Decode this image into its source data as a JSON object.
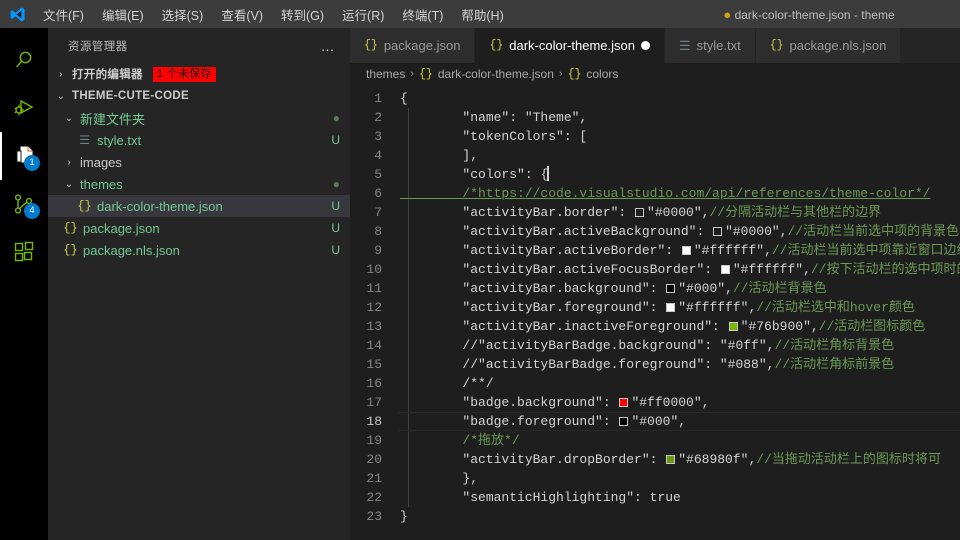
{
  "titlebar": {
    "logo_icon": "vscode-logo",
    "menus": [
      {
        "label": "文件(F)"
      },
      {
        "label": "编辑(E)"
      },
      {
        "label": "选择(S)"
      },
      {
        "label": "查看(V)"
      },
      {
        "label": "转到(G)"
      },
      {
        "label": "运行(R)"
      },
      {
        "label": "终端(T)"
      },
      {
        "label": "帮助(H)"
      }
    ],
    "dirty_dot": "●",
    "window_title": "dark-color-theme.json - theme"
  },
  "activitybar": {
    "items": [
      {
        "name": "search",
        "icon": "search-icon",
        "badge": null,
        "active": false
      },
      {
        "name": "run-and-debug",
        "icon": "run-debug-icon",
        "badge": null,
        "active": false
      },
      {
        "name": "explorer",
        "icon": "files-icon",
        "badge": "1",
        "active": true
      },
      {
        "name": "source-control",
        "icon": "source-control-icon",
        "badge": "4",
        "active": false
      },
      {
        "name": "extensions",
        "icon": "extensions-icon",
        "badge": null,
        "active": false
      }
    ],
    "badge_color": "#007acc",
    "icon_color": "#76b900"
  },
  "sidebar": {
    "title": "资源管理器",
    "more_actions": "…",
    "open_editors": {
      "label": "打开的编辑器",
      "badge": "1 个未保存",
      "badge_bg": "#ff0000",
      "twisty": "›"
    },
    "project": {
      "label": "THEME-CUTE-CODE",
      "twisty": "⌄"
    },
    "tree": [
      {
        "label": "新建文件夹",
        "type": "folder",
        "twisty": "⌄",
        "indent": 1,
        "status": "",
        "dot": true,
        "selected": false
      },
      {
        "label": "style.txt",
        "type": "txt",
        "twisty": "",
        "indent": 2,
        "status": "U",
        "dot": false,
        "selected": false
      },
      {
        "label": "images",
        "type": "folder",
        "twisty": "›",
        "indent": 1,
        "status": "",
        "dot": false,
        "selected": false
      },
      {
        "label": "themes",
        "type": "folder",
        "twisty": "⌄",
        "indent": 1,
        "status": "",
        "dot": true,
        "selected": false
      },
      {
        "label": "dark-color-theme.json",
        "type": "json",
        "twisty": "",
        "indent": 2,
        "status": "U",
        "dot": false,
        "selected": true
      },
      {
        "label": "package.json",
        "type": "json",
        "twisty": "",
        "indent": 1,
        "status": "U",
        "dot": false,
        "selected": false
      },
      {
        "label": "package.nls.json",
        "type": "json",
        "twisty": "",
        "indent": 1,
        "status": "U",
        "dot": false,
        "selected": false
      }
    ]
  },
  "editor": {
    "tabs": [
      {
        "label": "package.json",
        "icon": "json-icon",
        "active": false,
        "dirty": false
      },
      {
        "label": "dark-color-theme.json",
        "icon": "json-icon",
        "active": true,
        "dirty": true
      },
      {
        "label": "style.txt",
        "icon": "txt-icon",
        "active": false,
        "dirty": false
      },
      {
        "label": "package.nls.json",
        "icon": "json-icon",
        "active": false,
        "dirty": false
      }
    ],
    "breadcrumb": [
      {
        "label": "themes",
        "icon": ""
      },
      {
        "label": "dark-color-theme.json",
        "icon": "json-icon"
      },
      {
        "label": "colors",
        "icon": "json-icon"
      }
    ],
    "breadcrumb_separator": "›",
    "current_line": 18,
    "lines": [
      {
        "n": 1,
        "text": "{"
      },
      {
        "n": 2,
        "text": "        \"name\": \"Theme\","
      },
      {
        "n": 3,
        "text": "        \"tokenColors\": ["
      },
      {
        "n": 4,
        "text": "        ],"
      },
      {
        "n": 5,
        "text": "        \"colors\": {"
      },
      {
        "n": 6,
        "text": "        /*https://code.visualstudio.com/api/references/theme-color*/"
      },
      {
        "n": 7,
        "text": "        \"activityBar.border\":  \"#0000\",//分隔活动栏与其他栏的边界"
      },
      {
        "n": 8,
        "text": "        \"activityBar.activeBackground\":  \"#0000\",//活动栏当前选中项的背景色"
      },
      {
        "n": 9,
        "text": "        \"activityBar.activeBorder\":  \"#ffffff\",//活动栏当前选中项靠近窗口边缘的边框"
      },
      {
        "n": 10,
        "text": "        \"activityBar.activeFocusBorder\":  \"#ffffff\",//按下活动栏的选中项时的边框"
      },
      {
        "n": 11,
        "text": "        \"activityBar.background\":  \"#000\",//活动栏背景色"
      },
      {
        "n": 12,
        "text": "        \"activityBar.foreground\":  \"#ffffff\",//活动栏选中和hover颜色"
      },
      {
        "n": 13,
        "text": "        \"activityBar.inactiveForeground\":  \"#76b900\",//活动栏图标颜色"
      },
      {
        "n": 14,
        "text": "        //\"activityBarBadge.background\": \"#0ff\",//活动栏角标背景色"
      },
      {
        "n": 15,
        "text": "        //\"activityBarBadge.foreground\": \"#088\",//活动栏角标前景色"
      },
      {
        "n": 16,
        "text": "        /**/"
      },
      {
        "n": 17,
        "text": "        \"badge.background\":  \"#ff0000\","
      },
      {
        "n": 18,
        "text": "        \"badge.foreground\":  \"#000\","
      },
      {
        "n": 19,
        "text": "        /*拖放*/"
      },
      {
        "n": 20,
        "text": "        \"activityBar.dropBorder\":  \"#68980f\",//当拖动活动栏上的图标时将可"
      },
      {
        "n": 21,
        "text": "        },"
      },
      {
        "n": 22,
        "text": "        \"semanticHighlighting\": true"
      },
      {
        "n": 23,
        "text": "}"
      }
    ],
    "swatches": {
      "line7": "#0000",
      "line8": "#0000",
      "line9": "#ffffff",
      "line10": "#ffffff",
      "line11": "#000000",
      "line12": "#ffffff",
      "line13": "#76b900",
      "line17": "#ff0000",
      "line18": "#000000",
      "line20": "#68980f"
    },
    "comment_color": "#6a9955",
    "text_color": "#d4d4d4"
  }
}
